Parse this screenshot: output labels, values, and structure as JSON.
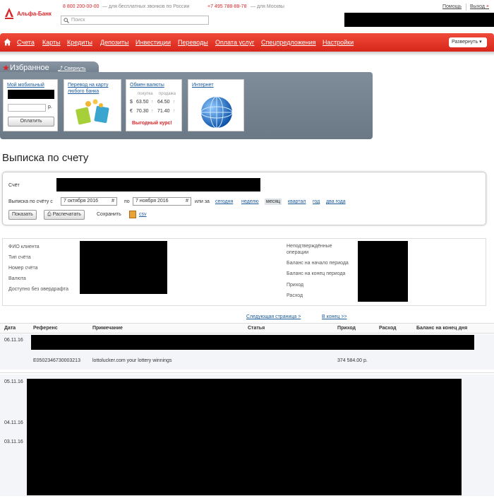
{
  "header": {
    "bank_name": "Альфа-Банк",
    "phone_free": "8 800 200-00-00",
    "phone_free_note": "— для бесплатных звонков по России",
    "phone_moscow": "+7 495 788-88-78",
    "phone_moscow_note": "— для Москвы",
    "help_label": "Помощь",
    "exit_label": "Выход",
    "search_placeholder": "Поиск"
  },
  "nav": {
    "items": [
      "Счета",
      "Карты",
      "Кредиты",
      "Депозиты",
      "Инвестиции",
      "Переводы",
      "Оплата услуг",
      "Спецпредложения",
      "Настройки"
    ],
    "expand_label": "Развернуть"
  },
  "favorites": {
    "title": "Избранное",
    "collapse_label": "Свернуть",
    "mobile": {
      "title": "Мой мобильный",
      "currency": "р.",
      "button": "Оплатить"
    },
    "transfer": {
      "title_line1": "Перевод на карту",
      "title_line2": "любого банка"
    },
    "fx": {
      "title": "Обмен валюты",
      "buy_label": "покупка",
      "sell_label": "продажа",
      "usd_symbol": "$",
      "usd_buy": "63.50",
      "usd_sell": "64.50",
      "eur_symbol": "€",
      "eur_buy": "70.30",
      "eur_sell": "71.40",
      "promo": "Выгодный курс!"
    },
    "internet": {
      "title": "Интернет"
    }
  },
  "statement": {
    "title": "Выписка по счету",
    "account_label": "Счёт",
    "period_label": "Выписка по счёту с",
    "date_from": "7 октября 2016",
    "to_label": "по",
    "date_to": "7 ноября 2016",
    "or_label": "или за",
    "periods": [
      "сегодня",
      "неделю",
      "месяц",
      "квартал",
      "год",
      "два года"
    ],
    "active_period": "месяц",
    "show_button": "Показать",
    "print_button": "Распечатать",
    "save_label": "Сохранить",
    "csv_label": "csv"
  },
  "info": {
    "left_labels": [
      "ФИО клиента",
      "Тип счёта",
      "Номер счёта",
      "Валюта",
      "Доступно без овердрафта"
    ],
    "right_labels": [
      "Неподтверждённые",
      "операции",
      "Баланс на начало периода",
      "Баланс на конец периода",
      "Приход",
      "Расход"
    ]
  },
  "table": {
    "next_page": "Следующая страница >",
    "to_end": "В конец >>",
    "columns": [
      "Дата",
      "Референс",
      "Примечание",
      "Статья",
      "Приход",
      "Расход",
      "Баланс на конец дня"
    ],
    "rows": [
      {
        "date": "06.11.16"
      },
      {
        "reference": "E0502346730003213",
        "note": "lottolucker.com your lottery winnings",
        "income": "374 584.00 р."
      },
      {
        "date": "05.11.16"
      },
      {
        "date": "04.11.16"
      },
      {
        "date": "03.11.16"
      }
    ]
  },
  "colors": {
    "brand_red": "#d8262b",
    "link": "#1a5a9a",
    "panel_gray": "#7f8c9a"
  }
}
